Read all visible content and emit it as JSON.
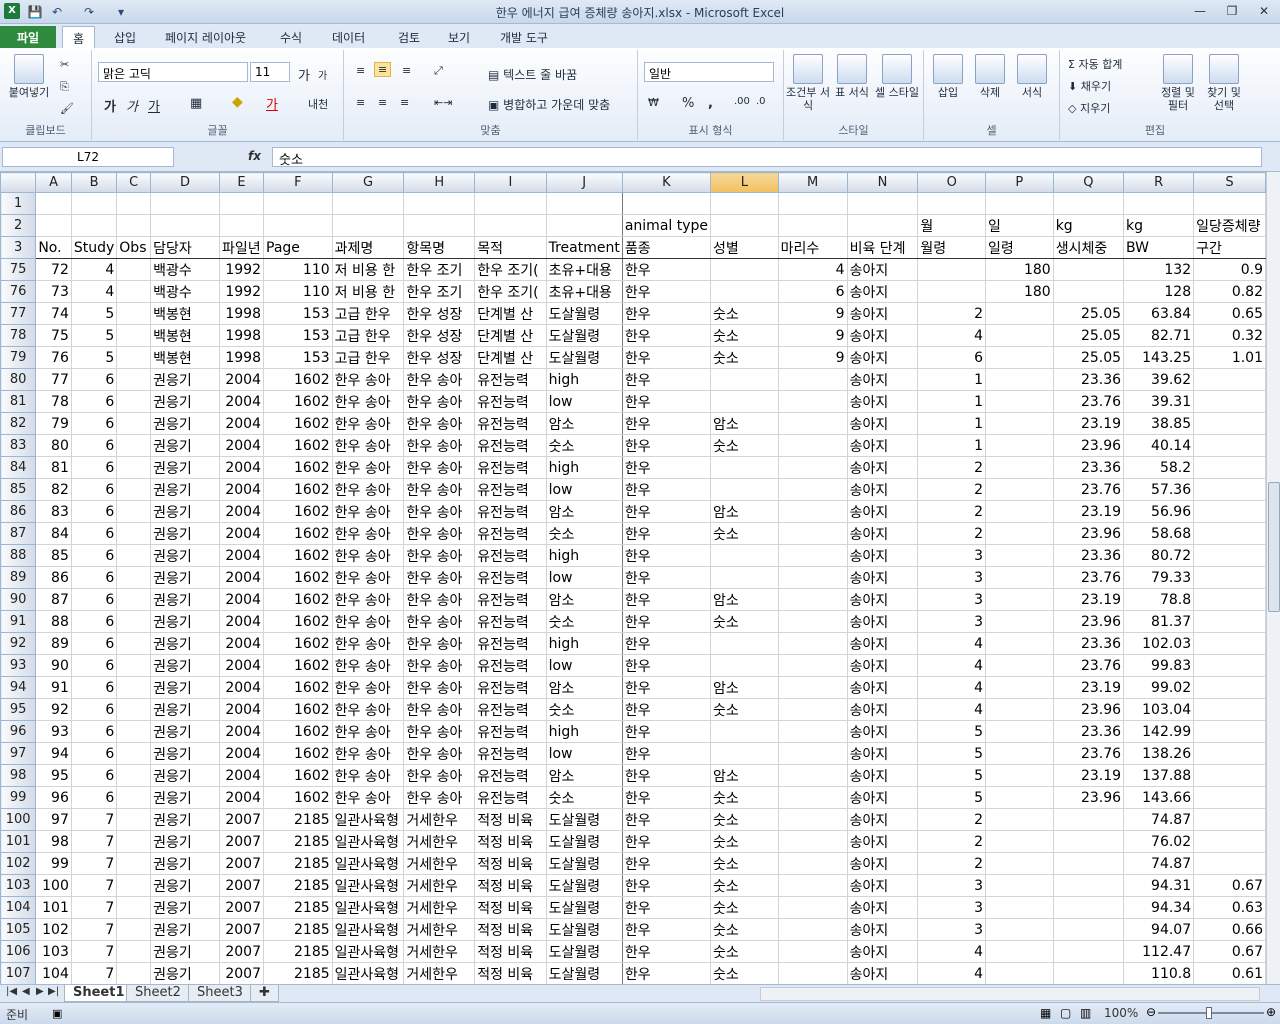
{
  "window": {
    "title": "한우 에너지 급여 증체량 송아지.xlsx - Microsoft Excel",
    "min": "—",
    "restore": "❐",
    "close": "✕"
  },
  "qat": {
    "save": "💾",
    "undo": "↶",
    "redo": "↷",
    "customize": "▾"
  },
  "tabs": [
    "파일",
    "홈",
    "삽입",
    "페이지 레이아웃",
    "수식",
    "데이터",
    "검토",
    "보기",
    "개발 도구"
  ],
  "ribbon": {
    "clipboard": {
      "paste": "붙여넣기",
      "label": "클립보드"
    },
    "font": {
      "name": "맑은 고딕",
      "size": "11",
      "grow": "가",
      "shrink": "가",
      "bold": "가",
      "italic": "가",
      "underline": "가",
      "label": "글꼴",
      "phonetic": "내천"
    },
    "align": {
      "wrap": "텍스트 줄 바꿈",
      "merge": "병합하고 가운데 맞춤",
      "label": "맞춤"
    },
    "number": {
      "format": "일반",
      "percent": "%",
      "comma": ",",
      "label": "표시 형식"
    },
    "styles": {
      "cond": "조건부 서식",
      "table": "표 서식",
      "cell": "셀 스타일",
      "label": "스타일"
    },
    "cells": {
      "insert": "삽입",
      "delete": "삭제",
      "format": "서식",
      "label": "셀"
    },
    "editing": {
      "autosum": "자동 합계",
      "fill": "채우기",
      "clear": "지우기",
      "sort": "정렬 및 필터",
      "find": "찾기 및 선택",
      "label": "편집"
    }
  },
  "formula_bar": {
    "namebox": "L72",
    "fx": "fx",
    "content": "숫소"
  },
  "grid": {
    "columns": [
      "A",
      "B",
      "C",
      "D",
      "E",
      "F",
      "G",
      "H",
      "I",
      "J",
      "K",
      "L",
      "M",
      "N",
      "O",
      "P",
      "Q",
      "R",
      "S"
    ],
    "header_rows": [
      {
        "row": "1",
        "cells": [
          "",
          "",
          "",
          "",
          "",
          "",
          "",
          "",
          "",
          "",
          "",
          "",
          "",
          "",
          "",
          "",
          "",
          "",
          ""
        ]
      },
      {
        "row": "2",
        "cells": [
          "",
          "",
          "",
          "",
          "",
          "",
          "",
          "",
          "",
          "",
          "animal type",
          "",
          "",
          "",
          "월",
          "일",
          "kg",
          "kg",
          "일당증체량"
        ]
      },
      {
        "row": "3",
        "cells": [
          "No.",
          "Study",
          "Obs",
          "담당자",
          "파일년",
          "Page",
          "과제명",
          "항목명",
          "목적",
          "Treatment",
          "품종",
          "성별",
          "마리수",
          "비육 단계",
          "월령",
          "일령",
          "생시체중",
          "BW",
          "구간"
        ]
      }
    ],
    "rows": [
      {
        "row": "75",
        "cells": [
          "72",
          "4",
          "",
          "백광수",
          "1992",
          "110",
          "저 비용 한",
          "한우 조기",
          "한우 조기(",
          "초유+대용",
          "한우",
          "",
          "4",
          "송아지",
          "",
          "180",
          "",
          "132",
          "0.9"
        ]
      },
      {
        "row": "76",
        "cells": [
          "73",
          "4",
          "",
          "백광수",
          "1992",
          "110",
          "저 비용 한",
          "한우 조기",
          "한우 조기(",
          "초유+대용",
          "한우",
          "",
          "6",
          "송아지",
          "",
          "180",
          "",
          "128",
          "0.82"
        ]
      },
      {
        "row": "77",
        "cells": [
          "74",
          "5",
          "",
          "백봉현",
          "1998",
          "153",
          "고급 한우",
          "한우 성장",
          "단계별 산",
          "도살월령",
          "한우",
          "숫소",
          "9",
          "송아지",
          "2",
          "",
          "25.05",
          "63.84",
          "0.65"
        ]
      },
      {
        "row": "78",
        "cells": [
          "75",
          "5",
          "",
          "백봉현",
          "1998",
          "153",
          "고급 한우",
          "한우 성장",
          "단계별 산",
          "도살월령",
          "한우",
          "숫소",
          "9",
          "송아지",
          "4",
          "",
          "25.05",
          "82.71",
          "0.32"
        ]
      },
      {
        "row": "79",
        "cells": [
          "76",
          "5",
          "",
          "백봉현",
          "1998",
          "153",
          "고급 한우",
          "한우 성장",
          "단계별 산",
          "도살월령",
          "한우",
          "숫소",
          "9",
          "송아지",
          "6",
          "",
          "25.05",
          "143.25",
          "1.01"
        ]
      },
      {
        "row": "80",
        "cells": [
          "77",
          "6",
          "",
          "권응기",
          "2004",
          "1602",
          "한우 송아",
          "한우 송아",
          "유전능력",
          "high",
          "한우",
          "",
          "",
          "송아지",
          "1",
          "",
          "23.36",
          "39.62",
          ""
        ]
      },
      {
        "row": "81",
        "cells": [
          "78",
          "6",
          "",
          "권응기",
          "2004",
          "1602",
          "한우 송아",
          "한우 송아",
          "유전능력",
          "low",
          "한우",
          "",
          "",
          "송아지",
          "1",
          "",
          "23.76",
          "39.31",
          ""
        ]
      },
      {
        "row": "82",
        "cells": [
          "79",
          "6",
          "",
          "권응기",
          "2004",
          "1602",
          "한우 송아",
          "한우 송아",
          "유전능력",
          "암소",
          "한우",
          "암소",
          "",
          "송아지",
          "1",
          "",
          "23.19",
          "38.85",
          ""
        ]
      },
      {
        "row": "83",
        "cells": [
          "80",
          "6",
          "",
          "권응기",
          "2004",
          "1602",
          "한우 송아",
          "한우 송아",
          "유전능력",
          "숫소",
          "한우",
          "숫소",
          "",
          "송아지",
          "1",
          "",
          "23.96",
          "40.14",
          ""
        ]
      },
      {
        "row": "84",
        "cells": [
          "81",
          "6",
          "",
          "권응기",
          "2004",
          "1602",
          "한우 송아",
          "한우 송아",
          "유전능력",
          "high",
          "한우",
          "",
          "",
          "송아지",
          "2",
          "",
          "23.36",
          "58.2",
          ""
        ]
      },
      {
        "row": "85",
        "cells": [
          "82",
          "6",
          "",
          "권응기",
          "2004",
          "1602",
          "한우 송아",
          "한우 송아",
          "유전능력",
          "low",
          "한우",
          "",
          "",
          "송아지",
          "2",
          "",
          "23.76",
          "57.36",
          ""
        ]
      },
      {
        "row": "86",
        "cells": [
          "83",
          "6",
          "",
          "권응기",
          "2004",
          "1602",
          "한우 송아",
          "한우 송아",
          "유전능력",
          "암소",
          "한우",
          "암소",
          "",
          "송아지",
          "2",
          "",
          "23.19",
          "56.96",
          ""
        ]
      },
      {
        "row": "87",
        "cells": [
          "84",
          "6",
          "",
          "권응기",
          "2004",
          "1602",
          "한우 송아",
          "한우 송아",
          "유전능력",
          "숫소",
          "한우",
          "숫소",
          "",
          "송아지",
          "2",
          "",
          "23.96",
          "58.68",
          ""
        ]
      },
      {
        "row": "88",
        "cells": [
          "85",
          "6",
          "",
          "권응기",
          "2004",
          "1602",
          "한우 송아",
          "한우 송아",
          "유전능력",
          "high",
          "한우",
          "",
          "",
          "송아지",
          "3",
          "",
          "23.36",
          "80.72",
          ""
        ]
      },
      {
        "row": "89",
        "cells": [
          "86",
          "6",
          "",
          "권응기",
          "2004",
          "1602",
          "한우 송아",
          "한우 송아",
          "유전능력",
          "low",
          "한우",
          "",
          "",
          "송아지",
          "3",
          "",
          "23.76",
          "79.33",
          ""
        ]
      },
      {
        "row": "90",
        "cells": [
          "87",
          "6",
          "",
          "권응기",
          "2004",
          "1602",
          "한우 송아",
          "한우 송아",
          "유전능력",
          "암소",
          "한우",
          "암소",
          "",
          "송아지",
          "3",
          "",
          "23.19",
          "78.8",
          ""
        ]
      },
      {
        "row": "91",
        "cells": [
          "88",
          "6",
          "",
          "권응기",
          "2004",
          "1602",
          "한우 송아",
          "한우 송아",
          "유전능력",
          "숫소",
          "한우",
          "숫소",
          "",
          "송아지",
          "3",
          "",
          "23.96",
          "81.37",
          ""
        ]
      },
      {
        "row": "92",
        "cells": [
          "89",
          "6",
          "",
          "권응기",
          "2004",
          "1602",
          "한우 송아",
          "한우 송아",
          "유전능력",
          "high",
          "한우",
          "",
          "",
          "송아지",
          "4",
          "",
          "23.36",
          "102.03",
          ""
        ]
      },
      {
        "row": "93",
        "cells": [
          "90",
          "6",
          "",
          "권응기",
          "2004",
          "1602",
          "한우 송아",
          "한우 송아",
          "유전능력",
          "low",
          "한우",
          "",
          "",
          "송아지",
          "4",
          "",
          "23.76",
          "99.83",
          ""
        ]
      },
      {
        "row": "94",
        "cells": [
          "91",
          "6",
          "",
          "권응기",
          "2004",
          "1602",
          "한우 송아",
          "한우 송아",
          "유전능력",
          "암소",
          "한우",
          "암소",
          "",
          "송아지",
          "4",
          "",
          "23.19",
          "99.02",
          ""
        ]
      },
      {
        "row": "95",
        "cells": [
          "92",
          "6",
          "",
          "권응기",
          "2004",
          "1602",
          "한우 송아",
          "한우 송아",
          "유전능력",
          "숫소",
          "한우",
          "숫소",
          "",
          "송아지",
          "4",
          "",
          "23.96",
          "103.04",
          ""
        ]
      },
      {
        "row": "96",
        "cells": [
          "93",
          "6",
          "",
          "권응기",
          "2004",
          "1602",
          "한우 송아",
          "한우 송아",
          "유전능력",
          "high",
          "한우",
          "",
          "",
          "송아지",
          "5",
          "",
          "23.36",
          "142.99",
          ""
        ]
      },
      {
        "row": "97",
        "cells": [
          "94",
          "6",
          "",
          "권응기",
          "2004",
          "1602",
          "한우 송아",
          "한우 송아",
          "유전능력",
          "low",
          "한우",
          "",
          "",
          "송아지",
          "5",
          "",
          "23.76",
          "138.26",
          ""
        ]
      },
      {
        "row": "98",
        "cells": [
          "95",
          "6",
          "",
          "권응기",
          "2004",
          "1602",
          "한우 송아",
          "한우 송아",
          "유전능력",
          "암소",
          "한우",
          "암소",
          "",
          "송아지",
          "5",
          "",
          "23.19",
          "137.88",
          ""
        ]
      },
      {
        "row": "99",
        "cells": [
          "96",
          "6",
          "",
          "권응기",
          "2004",
          "1602",
          "한우 송아",
          "한우 송아",
          "유전능력",
          "숫소",
          "한우",
          "숫소",
          "",
          "송아지",
          "5",
          "",
          "23.96",
          "143.66",
          ""
        ]
      },
      {
        "row": "100",
        "cells": [
          "97",
          "7",
          "",
          "권응기",
          "2007",
          "2185",
          "일관사육형",
          "거세한우",
          "적정 비육",
          "도살월령",
          "한우",
          "숫소",
          "",
          "송아지",
          "2",
          "",
          "",
          "74.87",
          ""
        ]
      },
      {
        "row": "101",
        "cells": [
          "98",
          "7",
          "",
          "권응기",
          "2007",
          "2185",
          "일관사육형",
          "거세한우",
          "적정 비육",
          "도살월령",
          "한우",
          "숫소",
          "",
          "송아지",
          "2",
          "",
          "",
          "76.02",
          ""
        ]
      },
      {
        "row": "102",
        "cells": [
          "99",
          "7",
          "",
          "권응기",
          "2007",
          "2185",
          "일관사육형",
          "거세한우",
          "적정 비육",
          "도살월령",
          "한우",
          "숫소",
          "",
          "송아지",
          "2",
          "",
          "",
          "74.87",
          ""
        ]
      },
      {
        "row": "103",
        "cells": [
          "100",
          "7",
          "",
          "권응기",
          "2007",
          "2185",
          "일관사육형",
          "거세한우",
          "적정 비육",
          "도살월령",
          "한우",
          "숫소",
          "",
          "송아지",
          "3",
          "",
          "",
          "94.31",
          "0.67"
        ]
      },
      {
        "row": "104",
        "cells": [
          "101",
          "7",
          "",
          "권응기",
          "2007",
          "2185",
          "일관사육형",
          "거세한우",
          "적정 비육",
          "도살월령",
          "한우",
          "숫소",
          "",
          "송아지",
          "3",
          "",
          "",
          "94.34",
          "0.63"
        ]
      },
      {
        "row": "105",
        "cells": [
          "102",
          "7",
          "",
          "권응기",
          "2007",
          "2185",
          "일관사육형",
          "거세한우",
          "적정 비육",
          "도살월령",
          "한우",
          "숫소",
          "",
          "송아지",
          "3",
          "",
          "",
          "94.07",
          "0.66"
        ]
      },
      {
        "row": "106",
        "cells": [
          "103",
          "7",
          "",
          "권응기",
          "2007",
          "2185",
          "일관사육형",
          "거세한우",
          "적정 비육",
          "도살월령",
          "한우",
          "숫소",
          "",
          "송아지",
          "4",
          "",
          "",
          "112.47",
          "0.67"
        ]
      },
      {
        "row": "107",
        "cells": [
          "104",
          "7",
          "",
          "권응기",
          "2007",
          "2185",
          "일관사육형",
          "거세한우",
          "적정 비육",
          "도살월령",
          "한우",
          "숫소",
          "",
          "송아지",
          "4",
          "",
          "",
          "110.8",
          "0.61"
        ]
      }
    ]
  },
  "sheets": [
    "Sheet1",
    "Sheet2",
    "Sheet3"
  ],
  "status": {
    "ready": "준비",
    "zoom": "100%"
  }
}
